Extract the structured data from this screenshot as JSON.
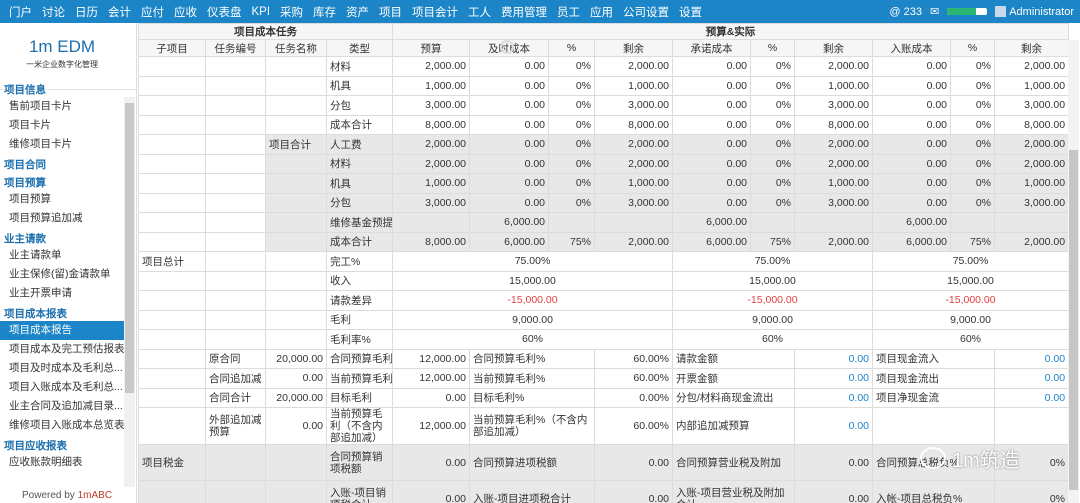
{
  "topnav": {
    "items": [
      "门户",
      "讨论",
      "日历",
      "会计",
      "应付",
      "应收",
      "仪表盘",
      "KPI",
      "采购",
      "库存",
      "资产",
      "项目",
      "项目会计",
      "工人",
      "费用管理",
      "员工",
      "应用",
      "公司设置",
      "设置"
    ],
    "notifications": "@ 233",
    "progress": 0.72,
    "user": "Administrator"
  },
  "sidebar": {
    "logo_title": "1m EDM",
    "logo_subtitle": "一米企业数字化管理",
    "sections": [
      {
        "title": "项目信息",
        "items": [
          "售前项目卡片",
          "项目卡片",
          "维修项目卡片"
        ]
      },
      {
        "title": "项目合同",
        "items": []
      },
      {
        "title": "项目预算",
        "items": [
          "项目预算",
          "项目预算追加减"
        ]
      },
      {
        "title": "业主请款",
        "items": [
          "业主请款单",
          "业主保修(留)金请款单",
          "业主开票申请"
        ]
      },
      {
        "title": "项目成本报表",
        "items": [
          "项目成本报告",
          "项目成本及完工预估报表",
          "项目及时成本及毛利总...",
          "项目入账成本及毛利总...",
          "业主合同及追加减目录...",
          "维修项目入账成本总览表"
        ]
      },
      {
        "title": "项目应收报表",
        "items": [
          "应收账款明细表"
        ]
      }
    ],
    "active_item": "项目成本报告",
    "powered_prefix": "Powered by ",
    "powered_brand": "1mABC"
  },
  "table": {
    "group_headers": [
      "项目成本任务",
      "预算&实际"
    ],
    "columns": [
      "子项目",
      "任务编号",
      "任务名称",
      "类型",
      "预算",
      "及时成本",
      "%",
      "剩余",
      "承诺成本",
      "%",
      "剩余",
      "入账成本",
      "%",
      "剩余"
    ],
    "cost_rows": [
      {
        "g": false,
        "name": "",
        "type": "材料",
        "v": [
          "2,000.00",
          "0.00",
          "0%",
          "2,000.00",
          "0.00",
          "0%",
          "2,000.00",
          "0.00",
          "0%",
          "2,000.00"
        ]
      },
      {
        "g": false,
        "name": "",
        "type": "机具",
        "v": [
          "1,000.00",
          "0.00",
          "0%",
          "1,000.00",
          "0.00",
          "0%",
          "1,000.00",
          "0.00",
          "0%",
          "1,000.00"
        ]
      },
      {
        "g": false,
        "name": "",
        "type": "分包",
        "v": [
          "3,000.00",
          "0.00",
          "0%",
          "3,000.00",
          "0.00",
          "0%",
          "3,000.00",
          "0.00",
          "0%",
          "3,000.00"
        ]
      },
      {
        "g": false,
        "name": "",
        "type": "成本合计",
        "v": [
          "8,000.00",
          "0.00",
          "0%",
          "8,000.00",
          "0.00",
          "0%",
          "8,000.00",
          "0.00",
          "0%",
          "8,000.00"
        ]
      },
      {
        "g": true,
        "name": "项目合计",
        "type": "人工费",
        "v": [
          "2,000.00",
          "0.00",
          "0%",
          "2,000.00",
          "0.00",
          "0%",
          "2,000.00",
          "0.00",
          "0%",
          "2,000.00"
        ]
      },
      {
        "g": true,
        "name": "",
        "type": "材料",
        "v": [
          "2,000.00",
          "0.00",
          "0%",
          "2,000.00",
          "0.00",
          "0%",
          "2,000.00",
          "0.00",
          "0%",
          "2,000.00"
        ]
      },
      {
        "g": true,
        "name": "",
        "type": "机具",
        "v": [
          "1,000.00",
          "0.00",
          "0%",
          "1,000.00",
          "0.00",
          "0%",
          "1,000.00",
          "0.00",
          "0%",
          "1,000.00"
        ]
      },
      {
        "g": true,
        "name": "",
        "type": "分包",
        "v": [
          "3,000.00",
          "0.00",
          "0%",
          "3,000.00",
          "0.00",
          "0%",
          "3,000.00",
          "0.00",
          "0%",
          "3,000.00"
        ]
      },
      {
        "g": true,
        "name": "",
        "type": "维修基金预提",
        "v": [
          "",
          "6,000.00",
          "",
          "",
          "6,000.00",
          "",
          "",
          "6,000.00",
          "",
          ""
        ]
      },
      {
        "g": true,
        "name": "",
        "type": "成本合计",
        "v": [
          "8,000.00",
          "6,000.00",
          "75%",
          "2,000.00",
          "6,000.00",
          "75%",
          "2,000.00",
          "6,000.00",
          "75%",
          "2,000.00"
        ]
      }
    ],
    "total_label": "项目总计",
    "summary_rows": [
      {
        "type": "完工%",
        "v": [
          "75.00%",
          "75.00%",
          "75.00%"
        ],
        "red": false
      },
      {
        "type": "收入",
        "v": [
          "15,000.00",
          "15,000.00",
          "15,000.00"
        ],
        "red": false
      },
      {
        "type": "请款差异",
        "v": [
          "-15,000.00",
          "-15,000.00",
          "-15,000.00"
        ],
        "red": true
      },
      {
        "type": "毛利",
        "v": [
          "9,000.00",
          "9,000.00",
          "9,000.00"
        ],
        "red": false
      },
      {
        "type": "毛利率%",
        "v": [
          "60%",
          "60%",
          "60%"
        ],
        "red": false
      }
    ],
    "contract_rows": [
      {
        "no": "原合同",
        "amt": "20,000.00",
        "l1": "合同预算毛利",
        "v1": "12,000.00",
        "l2": "合同预算毛利%",
        "v2": "60.00%",
        "l3": "请款金额",
        "v3": "0.00",
        "l4": "项目现金流入",
        "v4": "0.00"
      },
      {
        "no": "合同追加减",
        "amt": "0.00",
        "l1": "当前预算毛利",
        "v1": "12,000.00",
        "l2": "当前预算毛利%",
        "v2": "60.00%",
        "l3": "开票金额",
        "v3": "0.00",
        "l4": "项目现金流出",
        "v4": "0.00"
      },
      {
        "no": "合同合计",
        "amt": "20,000.00",
        "l1": "目标毛利",
        "v1": "0.00",
        "l2": "目标毛利%",
        "v2": "0.00%",
        "l3": "分包/材料商现金流出",
        "v3": "0.00",
        "l4": "项目净现金流",
        "v4": "0.00"
      },
      {
        "no": "外部追加减预算",
        "amt": "0.00",
        "l1": "当前预算毛利（不含内部追加减）",
        "v1": "12,000.00",
        "l2": "当前预算毛利%（不含内部追加减）",
        "v2": "60.00%",
        "l3": "内部追加减预算",
        "v3": "0.00",
        "l4": "",
        "v4": ""
      }
    ],
    "tax_label": "项目税金",
    "tax_rows": [
      {
        "l1": "合同预算销项税额",
        "v1": "0.00",
        "l2": "合同预算进项税额",
        "v2": "0.00",
        "l3": "合同预算营业税及附加",
        "v3": "0.00",
        "l4": "合同预算总税负%",
        "v4": "0%"
      },
      {
        "l1": "入账-项目销项税合计",
        "v1": "0.00",
        "l2": "入账-项目进项税合计",
        "v2": "0.00",
        "l3": "入账-项目营业税及附加合计",
        "v3": "0.00",
        "l4": "入帐-项目总税负%",
        "v4": "0%"
      }
    ]
  },
  "watermark": "1m筑造"
}
